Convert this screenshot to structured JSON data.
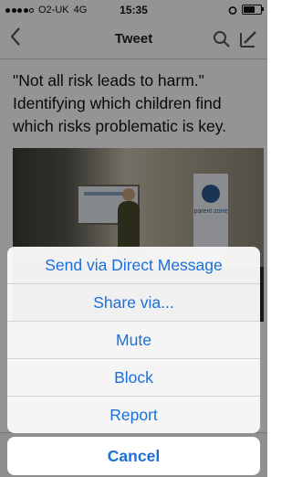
{
  "status_bar": {
    "carrier": "O2-UK",
    "network": "4G",
    "time": "15:35"
  },
  "nav": {
    "title": "Tweet",
    "back_icon": "chevron-left-icon",
    "search_icon": "search-icon",
    "compose_icon": "compose-icon"
  },
  "tweet": {
    "text": "\"Not all risk leads to harm.\" Identifying which children find which risks problematic is key.",
    "photo_banner_text": "parent zone"
  },
  "action_sheet": {
    "items": [
      "Send via Direct Message",
      "Share via...",
      "Mute",
      "Block",
      "Report"
    ],
    "cancel_label": "Cancel"
  },
  "colors": {
    "accent": "#1a6fd8",
    "overlay": "rgba(0,0,0,0.42)"
  }
}
